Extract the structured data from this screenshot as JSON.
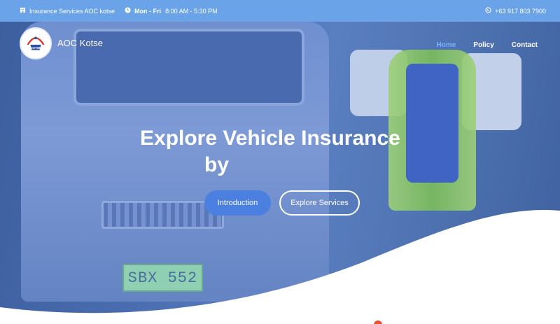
{
  "topbar": {
    "company": "Insurance Services AOC kotse",
    "hours_days": "Mon - Fri",
    "hours_time": "8:00 AM - 5:30 PM",
    "phone": "+63 917 803 7900",
    "icons": {
      "company": "building-icon",
      "hours": "clock-icon",
      "phone": "whatsapp-icon"
    }
  },
  "header": {
    "brand": "AOC Kotse",
    "logo_text": "KOTSE",
    "nav": [
      {
        "label": "Home",
        "active": true
      },
      {
        "label": "Policy",
        "active": false
      },
      {
        "label": "Contact",
        "active": false
      }
    ]
  },
  "hero": {
    "headline_line1": "Explore Vehicle Insurance",
    "headline_line2": "by",
    "buttons": {
      "primary": "Introduction",
      "secondary": "Explore Services"
    },
    "plate_text": "SBX 552"
  },
  "colors": {
    "topbar": "#6aa3e8",
    "nav_active": "#79b2ff",
    "primary_button": "#4b7fe0",
    "accent_dot": "#e8512e"
  }
}
